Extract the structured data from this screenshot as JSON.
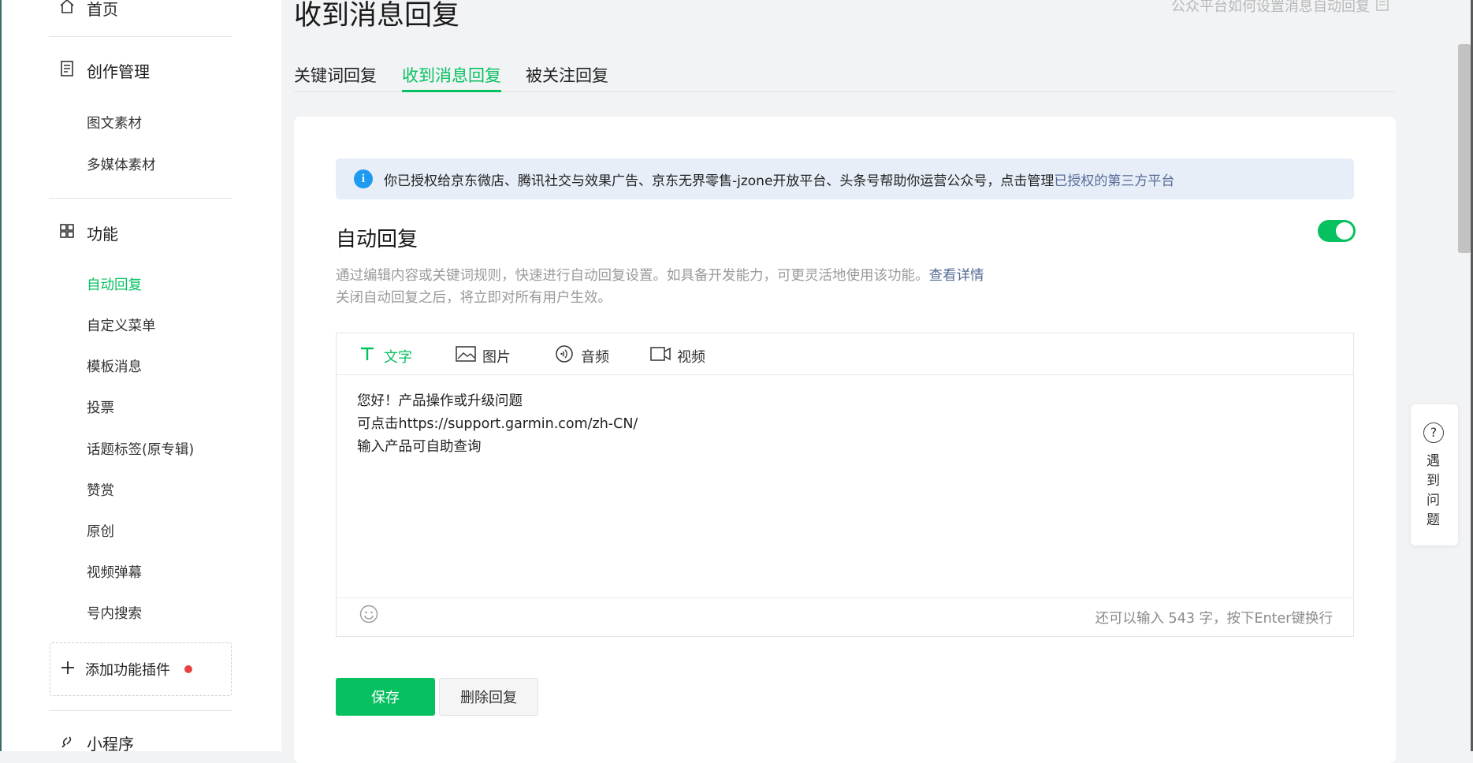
{
  "sidebar": {
    "home_label": "首页",
    "creation_label": "创作管理",
    "creation_items": [
      "图文素材",
      "多媒体素材"
    ],
    "features_label": "功能",
    "feature_items": [
      "自动回复",
      "自定义菜单",
      "模板消息",
      "投票",
      "话题标签(原专辑)",
      "赞赏",
      "原创",
      "视频弹幕",
      "号内搜索"
    ],
    "active_item": "自动回复",
    "add_plugin_label": "添加功能插件",
    "mini_program_label": "小程序"
  },
  "header": {
    "title": "收到消息回复",
    "help_link": "公众平台如何设置消息自动回复"
  },
  "tabs": [
    {
      "label": "关键词回复",
      "active": false
    },
    {
      "label": "收到消息回复",
      "active": true
    },
    {
      "label": "被关注回复",
      "active": false
    }
  ],
  "notice": {
    "text": "你已授权给京东微店、腾讯社交与效果广告、京东无界零售-jzone开放平台、头条号帮助你运营公众号，点击管理",
    "link": "已授权的第三方平台"
  },
  "auto_reply": {
    "title": "自动回复",
    "enabled": true,
    "desc_line1": "通过编辑内容或关键词规则，快速进行自动回复设置。如具备开发能力，可更灵活地使用该功能。",
    "desc_link": "查看详情",
    "desc_line2": "关闭自动回复之后，将立即对所有用户生效。"
  },
  "editor": {
    "tabs": [
      "文字",
      "图片",
      "音频",
      "视频"
    ],
    "active_tab": "文字",
    "content_lines": [
      "您好！产品操作或升级问题",
      "可点击https://support.garmin.com/zh-CN/",
      "输入产品可自助查询"
    ],
    "remaining_text": "还可以输入 543 字，按下Enter键换行"
  },
  "buttons": {
    "save": "保存",
    "delete": "删除回复"
  },
  "float_help": {
    "label": "遇到问题"
  },
  "colors": {
    "accent": "#07c160",
    "link": "#576b95",
    "info_bg": "#e7eef8",
    "danger_dot": "#e64340"
  }
}
